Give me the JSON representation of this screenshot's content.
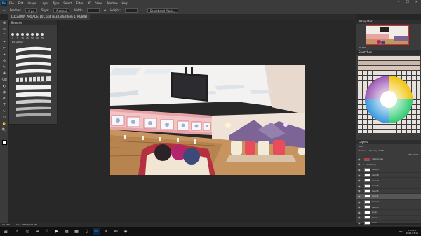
{
  "app": {
    "logo": "Ps",
    "menu": [
      "File",
      "Edit",
      "Image",
      "Layer",
      "Type",
      "Select",
      "Filter",
      "3D",
      "View",
      "Window",
      "Help"
    ],
    "window_controls": [
      "–",
      "☐",
      "✕"
    ]
  },
  "options_bar": {
    "feather_label": "Feather:",
    "feather_value": "0 px",
    "style_label": "Style:",
    "style_value": "Normal",
    "width_label": "Width:",
    "height_label": "Height:",
    "select_mask_button": "Select and Mask..."
  },
  "document": {
    "tab_title": "LOCATION_ARCADE_L01.psd @ 33.3% (Item 1, RGB/8)"
  },
  "tools": [
    "⊕",
    "▭",
    "⌒",
    "✦",
    "✂",
    "⌖",
    "⊘",
    "✎",
    "✚",
    "⌫",
    "◐",
    "◉",
    "✒",
    "T",
    "↖",
    "▭",
    "✋",
    "🔍",
    "…",
    "■"
  ],
  "brush_panel": {
    "title": "Brushes",
    "sizes": [
      "1",
      "5",
      "10",
      "25",
      "50",
      "60",
      "70"
    ],
    "folder": "Brushes"
  },
  "navigator": {
    "title": "Navigator",
    "zoom": "33.33%"
  },
  "swatches": {
    "title": "Swatches"
  },
  "layers": {
    "title": "Layers",
    "kind": "Kind",
    "blend": "Normal",
    "opacity": "Opacity: 100%",
    "fill": "Fill: 100%",
    "groups": [
      {
        "name": "references",
        "selected": false
      },
      {
        "name": "Sketching",
        "selected": false
      }
    ],
    "items": [
      {
        "name": "Sketch",
        "selected": false
      },
      {
        "name": "Item 8",
        "selected": false
      },
      {
        "name": "Item 7",
        "selected": false
      },
      {
        "name": "Item 6",
        "selected": false
      },
      {
        "name": "Item 5",
        "selected": false
      },
      {
        "name": "Item 1",
        "selected": true
      },
      {
        "name": "Item 2",
        "selected": false
      },
      {
        "name": "Item 3",
        "selected": false
      },
      {
        "name": "props",
        "selected": false
      },
      {
        "name": "bowl",
        "selected": false
      },
      {
        "name": "lanes",
        "selected": false
      },
      {
        "name": "bg",
        "selected": false
      }
    ]
  },
  "status": {
    "zoom": "33.33%",
    "doc": "Doc: 18.0M/210.1M"
  },
  "taskbar": {
    "search_icon": "⌕",
    "apps": [
      "◎",
      "⊞",
      "♪",
      "▶",
      "▤",
      "▦",
      "♫",
      "Ps",
      "⊛",
      "✉",
      "◈"
    ],
    "tray": "ENG",
    "time": "3:01 PM",
    "date": "2022-03-11"
  }
}
